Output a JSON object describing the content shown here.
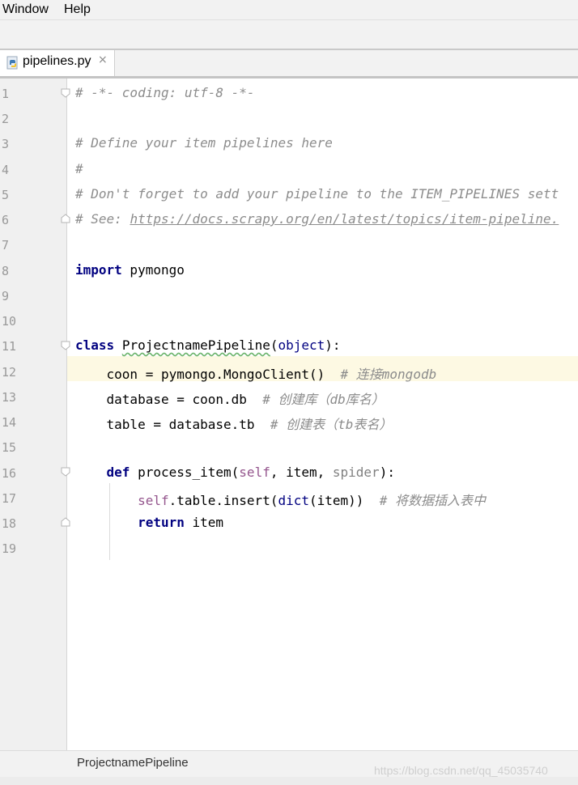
{
  "menu": {
    "window": "Window",
    "help": "Help"
  },
  "tab": {
    "label": "pipelines.py",
    "close": "×",
    "icon": "python-file-icon"
  },
  "editor": {
    "line_numbers": [
      "1",
      "2",
      "3",
      "4",
      "5",
      "6",
      "7",
      "8",
      "9",
      "10",
      "11",
      "12",
      "13",
      "14",
      "15",
      "16",
      "17",
      "18",
      "19"
    ],
    "highlighted_line": 12,
    "code": {
      "l1": "# -*- coding: utf-8 -*-",
      "l3": "# Define your item pipelines here",
      "l4": "#",
      "l5": "# Don't forget to add your pipeline to the ITEM_PIPELINES sett",
      "l6_prefix": "# See: ",
      "l6_url": "https://docs.scrapy.org/en/latest/topics/item-pipeline.",
      "l8_kw": "import",
      "l8_rest": " pymongo",
      "l11_kw": "class",
      "l11_name": "ProjectnamePipeline",
      "l11_open": "(",
      "l11_base": "object",
      "l11_close": "):",
      "l12_code": "    coon = pymongo.MongoClient()  ",
      "l12_comment": "# 连接mongodb",
      "l13_code": "    database = coon.db  ",
      "l13_comment": "# 创建库（db库名）",
      "l14_code": "    table = database.tb  ",
      "l14_comment": "# 创建表（tb表名）",
      "l16_indent": "    ",
      "l16_kw": "def",
      "l16_name": " process_item(",
      "l16_self": "self",
      "l16_mid": ", item, ",
      "l16_spider": "spider",
      "l16_end": "):",
      "l17_indent": "        ",
      "l17_self": "self",
      "l17_mid": ".table.insert(",
      "l17_dict": "dict",
      "l17_end": "(item))  ",
      "l17_comment": "# 将数据插入表中",
      "l18_indent": "        ",
      "l18_kw": "return",
      "l18_rest": " item"
    }
  },
  "status": {
    "breadcrumb": "ProjectnamePipeline",
    "watermark": "https://blog.csdn.net/qq_45035740"
  },
  "colors": {
    "keyword": "#000080",
    "comment": "#8c8c8c",
    "self": "#94558d",
    "line_highlight": "#fdf9e3"
  }
}
